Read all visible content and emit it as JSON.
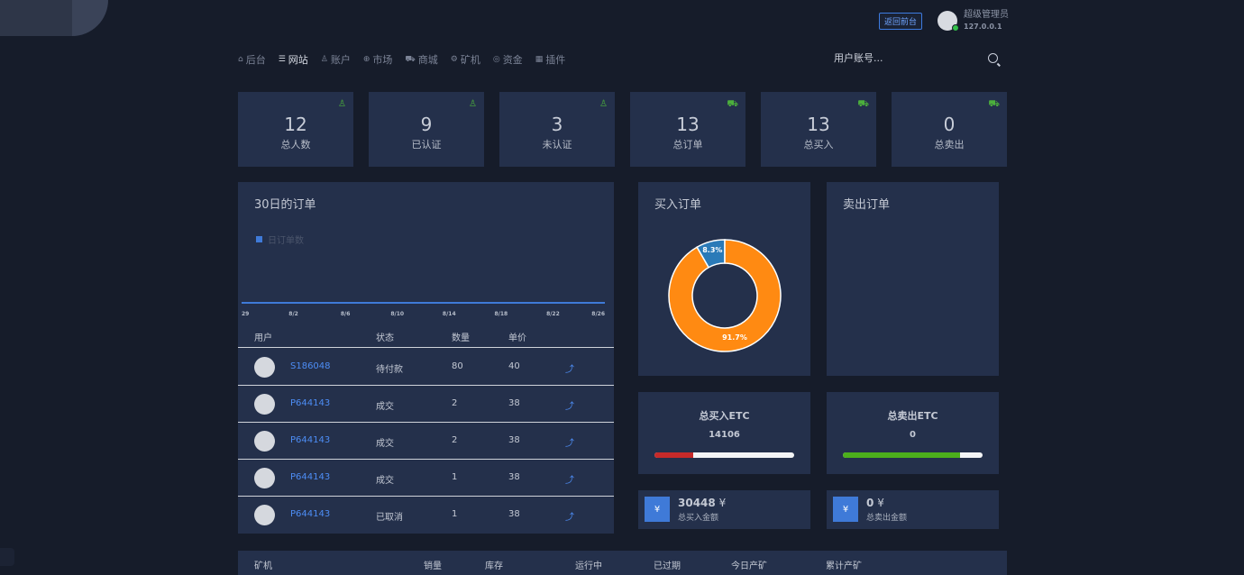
{
  "header": {
    "return_label": "返回前台",
    "user_name": "超级管理员",
    "user_ip": "127.0.0.1"
  },
  "nav": [
    {
      "icon": "home-icon",
      "glyph": "⌂",
      "label": "后台"
    },
    {
      "icon": "list-icon",
      "glyph": "☰",
      "label": "网站"
    },
    {
      "icon": "user-icon",
      "glyph": "♙",
      "label": "账户"
    },
    {
      "icon": "globe-icon",
      "glyph": "⊕",
      "label": "市场"
    },
    {
      "icon": "cart-icon",
      "glyph": "⛟",
      "label": "商城"
    },
    {
      "icon": "cog-icon",
      "glyph": "⚙",
      "label": "矿机"
    },
    {
      "icon": "coin-icon",
      "glyph": "◎",
      "label": "资金"
    },
    {
      "icon": "plugin-icon",
      "glyph": "▦",
      "label": "插件"
    }
  ],
  "search": {
    "placeholder": "用户账号..."
  },
  "stats": [
    {
      "value": "12",
      "label": "总人数",
      "icon": "user-icon"
    },
    {
      "value": "9",
      "label": "已认证",
      "icon": "user-icon"
    },
    {
      "value": "3",
      "label": "未认证",
      "icon": "user-icon"
    },
    {
      "value": "13",
      "label": "总订单",
      "icon": "cart-icon"
    },
    {
      "value": "13",
      "label": "总买入",
      "icon": "cart-icon"
    },
    {
      "value": "0",
      "label": "总卖出",
      "icon": "cart-icon"
    }
  ],
  "orders_panel": {
    "title": "30日的订单",
    "legend": "日订单数"
  },
  "chart_data": [
    {
      "type": "line",
      "series": [
        {
          "name": "日订单数",
          "color": "#3f7ad8",
          "values": [
            0,
            0,
            0,
            0,
            0,
            0,
            0,
            0
          ]
        }
      ],
      "x": [
        "29",
        "8/2",
        "8/6",
        "8/10",
        "8/14",
        "8/18",
        "8/22",
        "8/26"
      ]
    },
    {
      "type": "pie",
      "title": "买入订单",
      "categories": [
        "8.3%",
        "91.7%"
      ],
      "values": [
        8.3,
        91.7
      ],
      "colors": [
        "#2a7ab8",
        "#ff8a12"
      ]
    }
  ],
  "table": {
    "headers": {
      "user": "用户",
      "status": "状态",
      "qty": "数量",
      "price": "单价"
    },
    "rows": [
      {
        "id": "S186048",
        "status": "待付款",
        "qty": "80",
        "price": "40",
        "action": "⤴"
      },
      {
        "id": "P644143",
        "status": "成交",
        "qty": "2",
        "price": "38",
        "action": "⤴"
      },
      {
        "id": "P644143",
        "status": "成交",
        "qty": "2",
        "price": "38",
        "action": "⤴"
      },
      {
        "id": "P644143",
        "status": "成交",
        "qty": "1",
        "price": "38",
        "action": "⤴"
      },
      {
        "id": "P644143",
        "status": "已取消",
        "qty": "1",
        "price": "38",
        "action": "⤴"
      }
    ]
  },
  "buy_panel": {
    "title": "买入订单"
  },
  "sell_panel": {
    "title": "卖出订单"
  },
  "etc_buy": {
    "title": "总买入ETC",
    "value": "14106",
    "fill": 0.28,
    "color": "#c62a2a"
  },
  "etc_sell": {
    "title": "总卖出ETC",
    "value": "0",
    "fill": 0.84,
    "color": "#4caf1c"
  },
  "amount_buy": {
    "badge": "¥",
    "amount": "30448",
    "unit": "¥",
    "label": "总买入金额"
  },
  "amount_sell": {
    "badge": "¥",
    "amount": "0",
    "unit": "¥",
    "label": "总卖出金额"
  },
  "miner_table": {
    "headers": [
      "矿机",
      "销量",
      "库存",
      "运行中",
      "已过期",
      "今日产矿",
      "累计产矿"
    ]
  }
}
